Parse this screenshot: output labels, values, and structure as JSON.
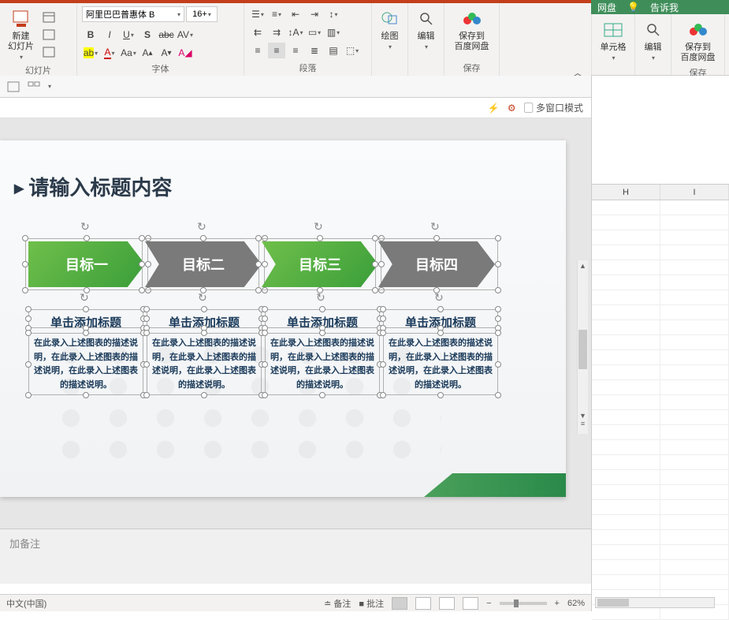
{
  "topTabsRight": {
    "wangpan": "网盘",
    "tellme": "告诉我"
  },
  "ribbon": {
    "groups": {
      "slides": {
        "label": "幻灯片",
        "newSlide": "新建\n幻灯片"
      },
      "font": {
        "label": "字体",
        "fontName": "阿里巴巴普惠体 B",
        "fontSize": "16+"
      },
      "paragraph": {
        "label": "段落"
      },
      "drawing": {
        "label": "绘图",
        "btn": "绘图"
      },
      "editing": {
        "label": "编辑",
        "btn": "编辑"
      },
      "saveBaidu": {
        "label": "保存",
        "btn": "保存到\n百度网盘"
      }
    }
  },
  "ribbonRight": {
    "cells": {
      "label": "单元格",
      "btn": "单元格"
    },
    "editing": {
      "label": "编辑",
      "btn": "编辑"
    },
    "saveBaidu": {
      "label": "保存",
      "btn": "保存到\n百度网盘"
    }
  },
  "infoBar": {
    "multiWindow": "多窗口模式"
  },
  "slide": {
    "title": "请输入标题内容",
    "arrows": [
      {
        "label": "目标一",
        "color": "green"
      },
      {
        "label": "目标二",
        "color": "gray"
      },
      {
        "label": "目标三",
        "color": "green"
      },
      {
        "label": "目标四",
        "color": "gray"
      }
    ],
    "blocks": [
      {
        "h": "单击添加标题",
        "p": "在此录入上述图表的描述说明，在此录入上述图表的描述说明，在此录入上述图表的描述说明。"
      },
      {
        "h": "单击添加标题",
        "p": "在此录入上述图表的描述说明，在此录入上述图表的描述说明，在此录入上述图表的描述说明。"
      },
      {
        "h": "单击添加标题",
        "p": "在此录入上述图表的描述说明，在此录入上述图表的描述说明，在此录入上述图表的描述说明。"
      },
      {
        "h": "单击添加标题",
        "p": "在此录入上述图表的描述说明，在此录入上述图表的描述说明，在此录入上述图表的描述说明。"
      }
    ]
  },
  "notes": {
    "placeholder": "加备注"
  },
  "statusBar": {
    "lang": "中文(中国)",
    "notesBtn": "备注",
    "commentsBtn": "批注",
    "zoom": "62%"
  },
  "excel": {
    "cols": [
      "H",
      "I"
    ]
  }
}
